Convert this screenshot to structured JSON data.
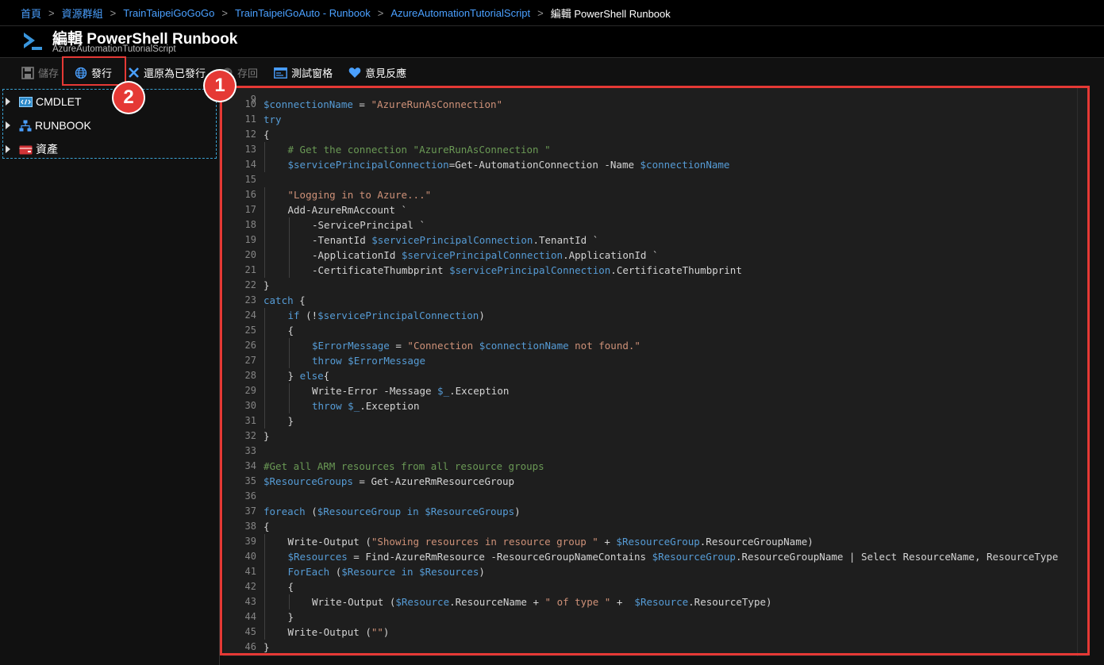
{
  "breadcrumb": {
    "items": [
      "首頁",
      "資源群組",
      "TrainTaipeiGoGoGo",
      "TrainTaipeiGoAuto - Runbook",
      "AzureAutomationTutorialScript"
    ],
    "current": "編輯 PowerShell Runbook",
    "separator": ">"
  },
  "header": {
    "title": "編輯 PowerShell Runbook",
    "subtitle": "AzureAutomationTutorialScript",
    "icon": "powershell-icon"
  },
  "toolbar": {
    "save_label": "儲存",
    "publish_label": "發行",
    "revert_label": "還原為已發行",
    "checkin_label": "存回",
    "test_pane_label": "測試窗格",
    "feedback_label": "意見反應"
  },
  "library": {
    "items": [
      {
        "label": "CMDLET",
        "icon": "cmdlet-icon"
      },
      {
        "label": "RUNBOOK",
        "icon": "runbook-icon"
      },
      {
        "label": "資產",
        "icon": "assets-icon"
      }
    ]
  },
  "annotations": {
    "badge1": "1",
    "badge2": "2"
  },
  "colors": {
    "accent": "#4aa0ff",
    "highlight": "#e53935",
    "editor_bg": "#1e1e1e",
    "variable": "#569cd6",
    "string": "#ce9178",
    "comment": "#6a9955"
  },
  "editor": {
    "first_partial_line": "9",
    "last_partial_line": "47",
    "lines": [
      {
        "n": "10",
        "indent": 0,
        "tokens": [
          [
            "v",
            "$connectionName"
          ],
          [
            "t",
            " = "
          ],
          [
            "s",
            "\"AzureRunAsConnection\""
          ]
        ]
      },
      {
        "n": "11",
        "indent": 0,
        "tokens": [
          [
            "k",
            "try"
          ]
        ]
      },
      {
        "n": "12",
        "indent": 0,
        "tokens": [
          [
            "t",
            "{"
          ]
        ]
      },
      {
        "n": "13",
        "indent": 1,
        "tokens": [
          [
            "c",
            "# Get the connection \"AzureRunAsConnection \""
          ]
        ]
      },
      {
        "n": "14",
        "indent": 1,
        "tokens": [
          [
            "v",
            "$servicePrincipalConnection"
          ],
          [
            "t",
            "=Get-AutomationConnection -Name "
          ],
          [
            "v",
            "$connectionName"
          ]
        ]
      },
      {
        "n": "15",
        "indent": 0,
        "tokens": []
      },
      {
        "n": "16",
        "indent": 1,
        "tokens": [
          [
            "s",
            "\"Logging in to Azure...\""
          ]
        ]
      },
      {
        "n": "17",
        "indent": 1,
        "tokens": [
          [
            "t",
            "Add-AzureRmAccount `"
          ]
        ]
      },
      {
        "n": "18",
        "indent": 2,
        "tokens": [
          [
            "t",
            "-ServicePrincipal `"
          ]
        ]
      },
      {
        "n": "19",
        "indent": 2,
        "tokens": [
          [
            "t",
            "-TenantId "
          ],
          [
            "v",
            "$servicePrincipalConnection"
          ],
          [
            "t",
            ".TenantId `"
          ]
        ]
      },
      {
        "n": "20",
        "indent": 2,
        "tokens": [
          [
            "t",
            "-ApplicationId "
          ],
          [
            "v",
            "$servicePrincipalConnection"
          ],
          [
            "t",
            ".ApplicationId `"
          ]
        ]
      },
      {
        "n": "21",
        "indent": 2,
        "tokens": [
          [
            "t",
            "-CertificateThumbprint "
          ],
          [
            "v",
            "$servicePrincipalConnection"
          ],
          [
            "t",
            ".CertificateThumbprint"
          ]
        ]
      },
      {
        "n": "22",
        "indent": 0,
        "tokens": [
          [
            "t",
            "}"
          ]
        ]
      },
      {
        "n": "23",
        "indent": 0,
        "tokens": [
          [
            "k",
            "catch"
          ],
          [
            "t",
            " {"
          ]
        ]
      },
      {
        "n": "24",
        "indent": 1,
        "tokens": [
          [
            "k",
            "if"
          ],
          [
            "t",
            " (!"
          ],
          [
            "v",
            "$servicePrincipalConnection"
          ],
          [
            "t",
            ")"
          ]
        ]
      },
      {
        "n": "25",
        "indent": 1,
        "tokens": [
          [
            "t",
            "{"
          ]
        ]
      },
      {
        "n": "26",
        "indent": 2,
        "tokens": [
          [
            "v",
            "$ErrorMessage"
          ],
          [
            "t",
            " = "
          ],
          [
            "s",
            "\"Connection "
          ],
          [
            "v",
            "$connectionName"
          ],
          [
            "s",
            " not found.\""
          ]
        ]
      },
      {
        "n": "27",
        "indent": 2,
        "tokens": [
          [
            "k",
            "throw"
          ],
          [
            "t",
            " "
          ],
          [
            "v",
            "$ErrorMessage"
          ]
        ]
      },
      {
        "n": "28",
        "indent": 1,
        "tokens": [
          [
            "t",
            "} "
          ],
          [
            "k",
            "else"
          ],
          [
            "t",
            "{"
          ]
        ]
      },
      {
        "n": "29",
        "indent": 2,
        "tokens": [
          [
            "t",
            "Write-Error -Message "
          ],
          [
            "v",
            "$_"
          ],
          [
            "t",
            ".Exception"
          ]
        ]
      },
      {
        "n": "30",
        "indent": 2,
        "tokens": [
          [
            "k",
            "throw"
          ],
          [
            "t",
            " "
          ],
          [
            "v",
            "$_"
          ],
          [
            "t",
            ".Exception"
          ]
        ]
      },
      {
        "n": "31",
        "indent": 1,
        "tokens": [
          [
            "t",
            "}"
          ]
        ]
      },
      {
        "n": "32",
        "indent": 0,
        "tokens": [
          [
            "t",
            "}"
          ]
        ]
      },
      {
        "n": "33",
        "indent": 0,
        "tokens": []
      },
      {
        "n": "34",
        "indent": 0,
        "tokens": [
          [
            "c",
            "#Get all ARM resources from all resource groups"
          ]
        ]
      },
      {
        "n": "35",
        "indent": 0,
        "tokens": [
          [
            "v",
            "$ResourceGroups"
          ],
          [
            "t",
            " = Get-AzureRmResourceGroup"
          ]
        ]
      },
      {
        "n": "36",
        "indent": 0,
        "tokens": []
      },
      {
        "n": "37",
        "indent": 0,
        "tokens": [
          [
            "k",
            "foreach"
          ],
          [
            "t",
            " ("
          ],
          [
            "v",
            "$ResourceGroup"
          ],
          [
            "t",
            " "
          ],
          [
            "k",
            "in"
          ],
          [
            "t",
            " "
          ],
          [
            "v",
            "$ResourceGroups"
          ],
          [
            "t",
            ")"
          ]
        ]
      },
      {
        "n": "38",
        "indent": 0,
        "tokens": [
          [
            "t",
            "{"
          ]
        ]
      },
      {
        "n": "39",
        "indent": 1,
        "tokens": [
          [
            "t",
            "Write-Output ("
          ],
          [
            "s",
            "\"Showing resources in resource group \""
          ],
          [
            "t",
            " + "
          ],
          [
            "v",
            "$ResourceGroup"
          ],
          [
            "t",
            ".ResourceGroupName)"
          ]
        ]
      },
      {
        "n": "40",
        "indent": 1,
        "tokens": [
          [
            "v",
            "$Resources"
          ],
          [
            "t",
            " = Find-AzureRmResource -ResourceGroupNameContains "
          ],
          [
            "v",
            "$ResourceGroup"
          ],
          [
            "t",
            ".ResourceGroupName | Select ResourceName, ResourceType"
          ]
        ]
      },
      {
        "n": "41",
        "indent": 1,
        "tokens": [
          [
            "k",
            "ForEach"
          ],
          [
            "t",
            " ("
          ],
          [
            "v",
            "$Resource"
          ],
          [
            "t",
            " "
          ],
          [
            "k",
            "in"
          ],
          [
            "t",
            " "
          ],
          [
            "v",
            "$Resources"
          ],
          [
            "t",
            ")"
          ]
        ]
      },
      {
        "n": "42",
        "indent": 1,
        "tokens": [
          [
            "t",
            "{"
          ]
        ]
      },
      {
        "n": "43",
        "indent": 2,
        "tokens": [
          [
            "t",
            "Write-Output ("
          ],
          [
            "v",
            "$Resource"
          ],
          [
            "t",
            ".ResourceName + "
          ],
          [
            "s",
            "\" of type \""
          ],
          [
            "t",
            " +  "
          ],
          [
            "v",
            "$Resource"
          ],
          [
            "t",
            ".ResourceType)"
          ]
        ]
      },
      {
        "n": "44",
        "indent": 1,
        "tokens": [
          [
            "t",
            "}"
          ]
        ]
      },
      {
        "n": "45",
        "indent": 1,
        "tokens": [
          [
            "t",
            "Write-Output ("
          ],
          [
            "s",
            "\"\""
          ],
          [
            "t",
            ")"
          ]
        ]
      },
      {
        "n": "46",
        "indent": 0,
        "tokens": [
          [
            "t",
            "}"
          ]
        ]
      }
    ]
  }
}
